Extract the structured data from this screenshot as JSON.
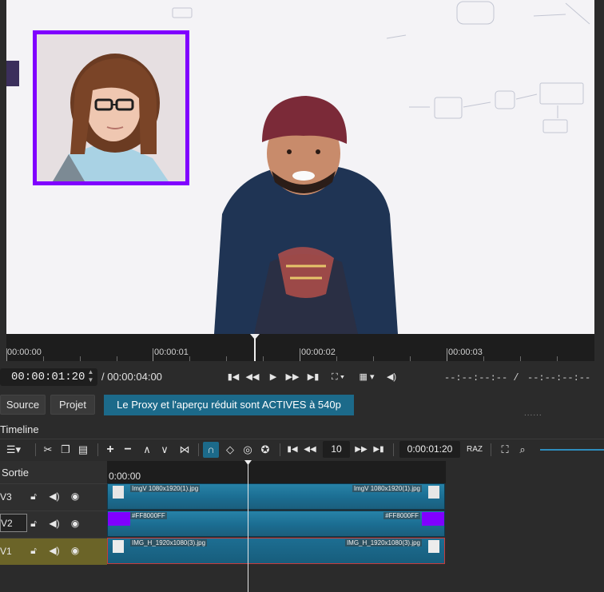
{
  "player": {
    "ruler_marks": [
      "00:00:00",
      "00:00:01",
      "00:00:02",
      "00:00:03"
    ]
  },
  "transport": {
    "current_timecode": "00:00:01:20",
    "total_duration": "/ 00:00:04:00",
    "in_point": "--:--:--:-- /",
    "out_point": "--:--:--:--",
    "icons": [
      "skip-start-icon",
      "rewind-icon",
      "play-icon",
      "fast-forward-icon",
      "skip-end-icon",
      "zoom-fit-icon",
      "grid-icon",
      "volume-icon"
    ]
  },
  "tabs": {
    "source": "Source",
    "project": "Projet",
    "proxy_banner": "Le Proxy et l'aperçu réduit sont ACTIVES à 540p",
    "grip": "......"
  },
  "timeline": {
    "title": "Timeline",
    "zoom_value": "10",
    "timecode": "0:00:01:20",
    "reset_label": "RAZ",
    "output_label": "Sortie",
    "ruler_start": "0:00:00",
    "tracks": [
      {
        "name": "V3",
        "clip_label_left": "ImgV 1080x1920(1).jpg",
        "clip_label_right": "ImgV 1080x1920(1).jpg"
      },
      {
        "name": "V2",
        "clip_label_left": "#FF8000FF",
        "clip_label_right": "#FF8000FF"
      },
      {
        "name": "V1",
        "clip_label_left": "IMG_H_1920x1080(3).jpg",
        "clip_label_right": "IMG_H_1920x1080(3).jpg"
      }
    ]
  },
  "colors": {
    "pip_border": "#8000ff",
    "banner": "#1c6a8a",
    "clip": "#1b6d91",
    "v1_header": "#6b6428",
    "active_selection": "#c83b3b"
  }
}
